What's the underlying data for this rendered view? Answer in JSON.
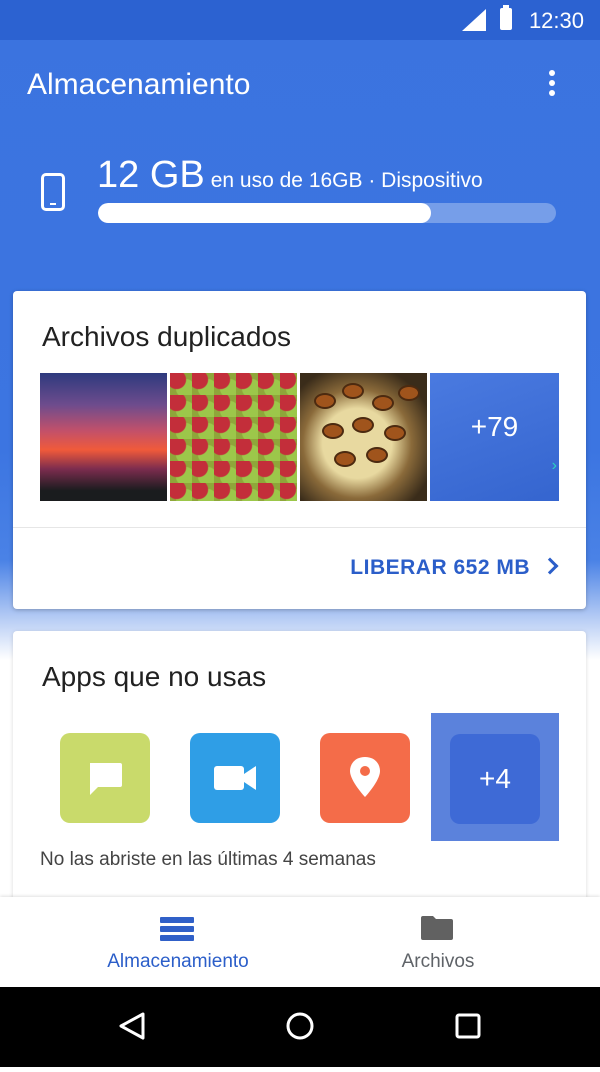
{
  "status_bar": {
    "time": "12:30"
  },
  "app_bar": {
    "title": "Almacenamiento"
  },
  "storage": {
    "used": "12 GB",
    "detail": "en uso de 16GB · Dispositivo",
    "used_fraction": 0.75
  },
  "duplicates": {
    "title": "Archivos duplicados",
    "more_count": "+79",
    "action": "LIBERAR 652 MB"
  },
  "unused_apps": {
    "title": "Apps que no usas",
    "more_count": "+4",
    "note": "No las abriste en las últimas 4 semanas"
  },
  "bottom_nav": {
    "items": [
      {
        "label": "Almacenamiento",
        "icon": "storage-icon"
      },
      {
        "label": "Archivos",
        "icon": "folder-icon"
      }
    ]
  },
  "colors": {
    "primary": "#3b73df",
    "accent": "#2b5ec9"
  }
}
